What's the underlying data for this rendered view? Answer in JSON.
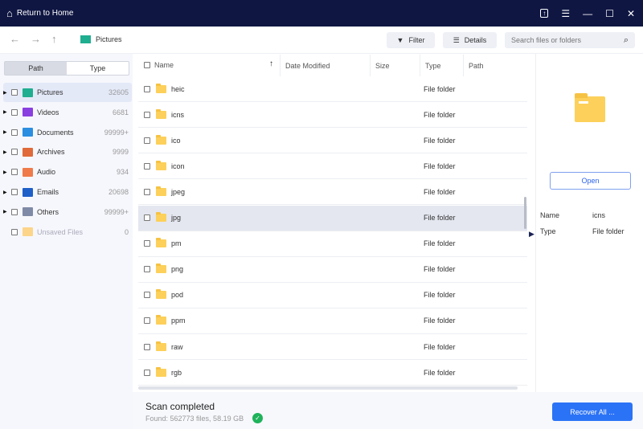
{
  "titlebar": {
    "home_label": "Return to Home"
  },
  "toolbar": {
    "breadcrumb": "Pictures",
    "filter_label": "Filter",
    "details_label": "Details",
    "search_placeholder": "Search files or folders"
  },
  "sidebar": {
    "tabs": [
      "Path",
      "Type"
    ],
    "categories": [
      {
        "label": "Pictures",
        "count": "32605",
        "color": "#1fae8f"
      },
      {
        "label": "Videos",
        "count": "6681",
        "color": "#8a3fe0"
      },
      {
        "label": "Documents",
        "count": "99999+",
        "color": "#2b8ee0"
      },
      {
        "label": "Archives",
        "count": "9999",
        "color": "#e06a3a"
      },
      {
        "label": "Audio",
        "count": "934",
        "color": "#ef7a4a"
      },
      {
        "label": "Emails",
        "count": "20698",
        "color": "#1f5fc8"
      },
      {
        "label": "Others",
        "count": "99999+",
        "color": "#7f8aa6"
      },
      {
        "label": "Unsaved Files",
        "count": "0",
        "color": "#fcd58a"
      }
    ]
  },
  "table": {
    "columns": [
      "Name",
      "Date Modified",
      "Size",
      "Type",
      "Path"
    ],
    "rows": [
      {
        "name": "heic",
        "type": "File folder"
      },
      {
        "name": "icns",
        "type": "File folder"
      },
      {
        "name": "ico",
        "type": "File folder"
      },
      {
        "name": "icon",
        "type": "File folder"
      },
      {
        "name": "jpeg",
        "type": "File folder"
      },
      {
        "name": "jpg",
        "type": "File folder"
      },
      {
        "name": "pm",
        "type": "File folder"
      },
      {
        "name": "png",
        "type": "File folder"
      },
      {
        "name": "pod",
        "type": "File folder"
      },
      {
        "name": "ppm",
        "type": "File folder"
      },
      {
        "name": "raw",
        "type": "File folder"
      },
      {
        "name": "rgb",
        "type": "File folder"
      }
    ]
  },
  "preview": {
    "open_label": "Open",
    "name_label": "Name",
    "name_value": "icns",
    "type_label": "Type",
    "type_value": "File folder"
  },
  "status": {
    "title": "Scan completed",
    "summary": "Found: 562773 files, 58.19 GB",
    "recover_label": "Recover All ..."
  }
}
